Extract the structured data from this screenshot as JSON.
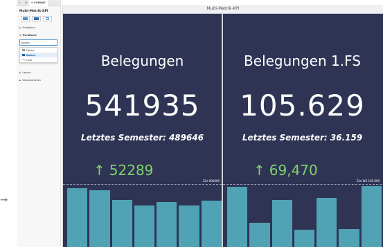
{
  "panel": {
    "tabs": [
      "✎",
      "⊞",
      "⚙ FORMAT"
    ],
    "title": "Multi-Metrik-KPI",
    "sections": {
      "schablone": "Schablone",
      "trendform": "Trendform",
      "layout": "Layout",
      "hintergrund": "Sekundärzeilen"
    },
    "trendform_select": "Balken",
    "dropdown_options": [
      "Fläche",
      "Balken",
      "Linie"
    ]
  },
  "dashboard": {
    "title": "Multi-Metrik-KPI",
    "kpis": [
      {
        "title": "Belegungen",
        "value": "541935",
        "previous": "Letztes Semester: 489646",
        "delta": "52289",
        "ref_label": "Ziel 600000",
        "bars": [
          0.83,
          0.8,
          0.66,
          0.58,
          0.63,
          0.58,
          0.65
        ]
      },
      {
        "title": "Belegungen 1.FS",
        "value": "105.629",
        "previous": "Letztes Semester: 36.159",
        "delta": "69,470",
        "ref_label": "Ziel WS 105.000",
        "bars": [
          0.84,
          0.34,
          0.66,
          0.24,
          0.69,
          0.25,
          0.85
        ]
      }
    ]
  },
  "colors": {
    "dashboard_bg": "#2f3454",
    "bar": "#4fa3b4",
    "delta_up": "#7ed26a"
  }
}
